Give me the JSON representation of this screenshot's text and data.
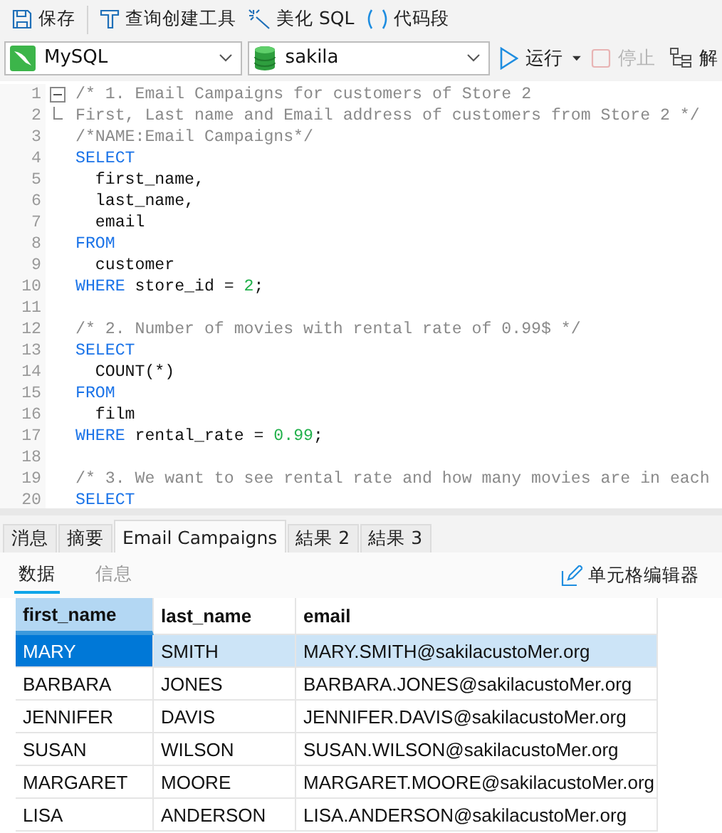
{
  "toolbar": {
    "items": [
      {
        "kind": "save",
        "label": "保存"
      },
      {
        "kind": "builder",
        "label": "查询创建工具"
      },
      {
        "kind": "beautify",
        "label": "美化 SQL"
      },
      {
        "kind": "snippet",
        "label": "代码段"
      }
    ]
  },
  "connection_bar": {
    "connection": {
      "kind": "mysql",
      "value": "MySQL"
    },
    "database": {
      "kind": "db",
      "value": "sakila"
    },
    "actions": [
      {
        "kind": "run",
        "label": "运行",
        "disabled": false
      },
      {
        "kind": "stop",
        "label": "停止",
        "disabled": true
      },
      {
        "kind": "explain",
        "label": "解",
        "disabled": false
      }
    ]
  },
  "editor": {
    "lines": [
      {
        "number": "1",
        "fold_open": true,
        "tokens": [
          {
            "kind": "comment",
            "text": "/* 1. Email Campaigns for customers of Store 2"
          }
        ]
      },
      {
        "number": "2",
        "fold_end": true,
        "tokens": [
          {
            "kind": "comment",
            "text": "First, Last name and Email address of customers from Store 2 */"
          }
        ]
      },
      {
        "number": "3",
        "tokens": [
          {
            "kind": "comment",
            "text": "/*NAME:Email Campaigns*/"
          }
        ]
      },
      {
        "number": "4",
        "tokens": [
          {
            "kind": "keyword",
            "text": "SELECT"
          }
        ]
      },
      {
        "number": "5",
        "tokens": [
          {
            "kind": "plain",
            "text": "  first_name,"
          }
        ]
      },
      {
        "number": "6",
        "tokens": [
          {
            "kind": "plain",
            "text": "  last_name,"
          }
        ]
      },
      {
        "number": "7",
        "tokens": [
          {
            "kind": "plain",
            "text": "  email"
          }
        ]
      },
      {
        "number": "8",
        "tokens": [
          {
            "kind": "keyword",
            "text": "FROM"
          }
        ]
      },
      {
        "number": "9",
        "tokens": [
          {
            "kind": "plain",
            "text": "  customer"
          }
        ]
      },
      {
        "number": "10",
        "tokens": [
          {
            "kind": "keyword",
            "text": "WHERE"
          },
          {
            "kind": "plain",
            "text": " store_id = "
          },
          {
            "kind": "number",
            "text": "2"
          },
          {
            "kind": "plain",
            "text": ";"
          }
        ]
      },
      {
        "number": "11"
      },
      {
        "number": "12",
        "tokens": [
          {
            "kind": "comment",
            "text": "/* 2. Number of movies with rental rate of 0.99$ */"
          }
        ]
      },
      {
        "number": "13",
        "tokens": [
          {
            "kind": "keyword",
            "text": "SELECT"
          }
        ]
      },
      {
        "number": "14",
        "tokens": [
          {
            "kind": "plain",
            "text": "  COUNT(*)"
          }
        ]
      },
      {
        "number": "15",
        "tokens": [
          {
            "kind": "keyword",
            "text": "FROM"
          }
        ]
      },
      {
        "number": "16",
        "tokens": [
          {
            "kind": "plain",
            "text": "  film"
          }
        ]
      },
      {
        "number": "17",
        "tokens": [
          {
            "kind": "keyword",
            "text": "WHERE"
          },
          {
            "kind": "plain",
            "text": " rental_rate = "
          },
          {
            "kind": "number",
            "text": "0.99"
          },
          {
            "kind": "plain",
            "text": ";"
          }
        ]
      },
      {
        "number": "18"
      },
      {
        "number": "19",
        "tokens": [
          {
            "kind": "comment",
            "text": "/* 3. We want to see rental rate and how many movies are in each"
          }
        ]
      },
      {
        "number": "20",
        "tokens": [
          {
            "kind": "keyword",
            "text": "SELECT"
          }
        ]
      }
    ]
  },
  "result_tabs": [
    {
      "label": "消息",
      "selected": false
    },
    {
      "label": "摘要",
      "selected": false
    },
    {
      "label": "Email Campaigns",
      "selected": true
    },
    {
      "label": "結果 2",
      "selected": false
    },
    {
      "label": "結果 3",
      "selected": false
    }
  ],
  "view_tabs": [
    {
      "label": "数据",
      "selected": true
    },
    {
      "label": "信息",
      "selected": false
    }
  ],
  "cell_editor_button": "单元格编辑器",
  "table": {
    "columns": [
      {
        "label": "first_name",
        "selected": true
      },
      {
        "label": "last_name",
        "selected": false
      },
      {
        "label": "email",
        "selected": false
      }
    ],
    "rows": [
      {
        "selected": true,
        "cells": [
          "MARY",
          "SMITH",
          "MARY.SMITH@sakilacustoMer.org"
        ]
      },
      {
        "selected": false,
        "cells": [
          "BARBARA",
          "JONES",
          "BARBARA.JONES@sakilacustoMer.org"
        ]
      },
      {
        "selected": false,
        "cells": [
          "JENNIFER",
          "DAVIS",
          "JENNIFER.DAVIS@sakilacustoMer.org"
        ]
      },
      {
        "selected": false,
        "cells": [
          "SUSAN",
          "WILSON",
          "SUSAN.WILSON@sakilacustoMer.org"
        ]
      },
      {
        "selected": false,
        "cells": [
          "MARGARET",
          "MOORE",
          "MARGARET.MOORE@sakilacustoMer.org"
        ]
      },
      {
        "selected": false,
        "cells": [
          "LISA",
          "ANDERSON",
          "LISA.ANDERSON@sakilacustoMer.org"
        ]
      }
    ]
  }
}
